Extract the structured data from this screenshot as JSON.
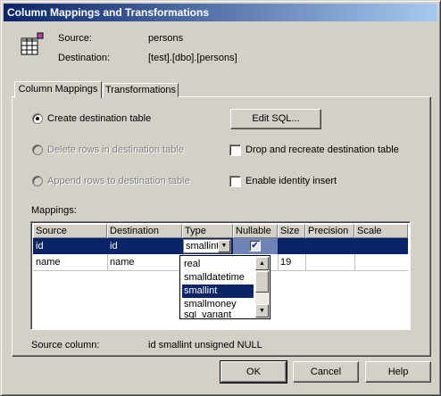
{
  "window": {
    "title": "Column Mappings and Transformations"
  },
  "info": {
    "source_label": "Source:",
    "source_value": "persons",
    "destination_label": "Destination:",
    "destination_value": "[test].[dbo].[persons]"
  },
  "tabs": [
    {
      "label": "Column Mappings",
      "selected": true
    },
    {
      "label": "Transformations",
      "selected": false
    }
  ],
  "options": {
    "create_table": "Create destination table",
    "delete_rows": "Delete rows in destination table",
    "append_rows": "Append rows to destination table",
    "edit_sql": "Edit SQL...",
    "drop_recreate": "Drop and recreate destination table",
    "identity_insert": "Enable identity insert"
  },
  "mappings": {
    "label": "Mappings:",
    "columns": [
      "Source",
      "Destination",
      "Type",
      "Nullable",
      "Size",
      "Precision",
      "Scale"
    ],
    "rows": [
      {
        "source": "id",
        "destination": "id",
        "type": "smallint",
        "nullable": true,
        "size": "",
        "precision": "",
        "scale": ""
      },
      {
        "source": "name",
        "destination": "name",
        "type": "",
        "nullable": false,
        "size": "19",
        "precision": "",
        "scale": ""
      }
    ],
    "type_options": [
      "real",
      "smalldatetime",
      "smallint",
      "smallmoney",
      "sql_variant"
    ],
    "selected_type": "smallint"
  },
  "source_column": {
    "label": "Source column:",
    "value": "id smallint unsigned NULL"
  },
  "buttons": {
    "ok": "OK",
    "cancel": "Cancel",
    "help": "Help"
  },
  "colors": {
    "title_start": "#0a246a",
    "title_end": "#a6caf0",
    "selection": "#0a246a",
    "face": "#d4d0c8"
  }
}
